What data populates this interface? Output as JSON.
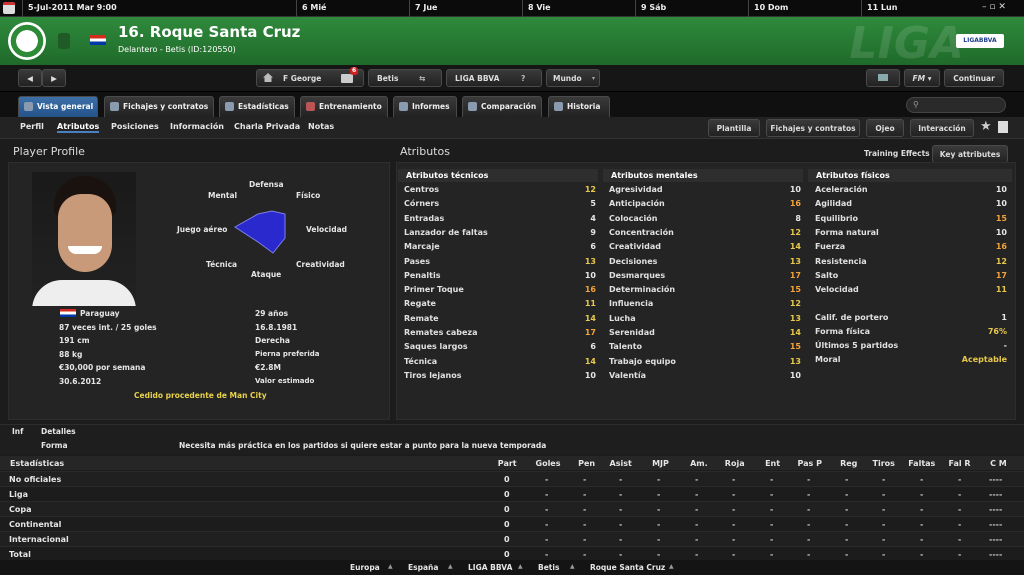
{
  "topbar": {
    "date": "5-Jul-2011 Mar 9:00",
    "days": [
      "6 Mié",
      "7 Jue",
      "8 Vie",
      "9 Sáb",
      "10 Dom",
      "11 Lun"
    ]
  },
  "player": {
    "title": "16. Roque Santa Cruz",
    "subtitle": "Delantero - Betis (ID:120550)"
  },
  "header": {
    "liga_watermark": "LIGA",
    "liga_logo": "LIGABBVA"
  },
  "toolbar": {
    "manager": "F George",
    "mail_count": "6",
    "club": "Betis",
    "league": "LIGA BBVA",
    "world": "Mundo",
    "fm": "FM",
    "continue": "Continuar"
  },
  "tabs": [
    "Vista general",
    "Fichajes y contratos",
    "Estadísticas",
    "Entrenamiento",
    "Informes",
    "Comparación",
    "Historia"
  ],
  "subtabs": [
    "Perfil",
    "Atributos",
    "Posiciones",
    "Información",
    "Charla Privada",
    "Notas"
  ],
  "actions": [
    "Plantilla",
    "Fichajes y contratos",
    "Ojeo",
    "Interacción"
  ],
  "profile": {
    "title": "Player Profile",
    "radar_labels": [
      "Defensa",
      "Físico",
      "Velocidad",
      "Creatividad",
      "Ataque",
      "Técnica",
      "Juego aéreo",
      "Mental"
    ],
    "nation": "Paraguay",
    "caps": "87 veces int. / 25 goles",
    "height": "191 cm",
    "weight": "88 kg",
    "wage": "€30,000 por semana",
    "contract": "30.6.2012",
    "age": "29 años",
    "dob": "16.8.1981",
    "foot": "Derecha",
    "foot_label": "Pierna preferida",
    "value": "€2.8M",
    "value_label": "Valor estimado",
    "loan": "Cedido procedente de Man City"
  },
  "attributes": {
    "title": "Atributos",
    "training_effects": "Training Effects",
    "key_attributes": "Key attributes",
    "technical_title": "Atributos técnicos",
    "mental_title": "Atributos mentales",
    "physical_title": "Atributos físicos",
    "technical": [
      {
        "n": "Centros",
        "v": "12"
      },
      {
        "n": "Córners",
        "v": "5"
      },
      {
        "n": "Entradas",
        "v": "4"
      },
      {
        "n": "Lanzador de faltas",
        "v": "9"
      },
      {
        "n": "Marcaje",
        "v": "6"
      },
      {
        "n": "Pases",
        "v": "13"
      },
      {
        "n": "Penaltis",
        "v": "10"
      },
      {
        "n": "Primer Toque",
        "v": "16"
      },
      {
        "n": "Regate",
        "v": "11"
      },
      {
        "n": "Remate",
        "v": "14"
      },
      {
        "n": "Remates cabeza",
        "v": "17"
      },
      {
        "n": "Saques largos",
        "v": "6"
      },
      {
        "n": "Técnica",
        "v": "14"
      },
      {
        "n": "Tiros lejanos",
        "v": "10"
      }
    ],
    "mental": [
      {
        "n": "Agresividad",
        "v": "10"
      },
      {
        "n": "Anticipación",
        "v": "16"
      },
      {
        "n": "Colocación",
        "v": "8"
      },
      {
        "n": "Concentración",
        "v": "12"
      },
      {
        "n": "Creatividad",
        "v": "14"
      },
      {
        "n": "Decisiones",
        "v": "13"
      },
      {
        "n": "Desmarques",
        "v": "17"
      },
      {
        "n": "Determinación",
        "v": "15"
      },
      {
        "n": "Influencia",
        "v": "12"
      },
      {
        "n": "Lucha",
        "v": "13"
      },
      {
        "n": "Serenidad",
        "v": "14"
      },
      {
        "n": "Talento",
        "v": "15"
      },
      {
        "n": "Trabajo equipo",
        "v": "13"
      },
      {
        "n": "Valentía",
        "v": "10"
      }
    ],
    "physical": [
      {
        "n": "Aceleración",
        "v": "10"
      },
      {
        "n": "Agilidad",
        "v": "10"
      },
      {
        "n": "Equilibrio",
        "v": "15"
      },
      {
        "n": "Forma natural",
        "v": "10"
      },
      {
        "n": "Fuerza",
        "v": "16"
      },
      {
        "n": "Resistencia",
        "v": "12"
      },
      {
        "n": "Salto",
        "v": "17"
      },
      {
        "n": "Velocidad",
        "v": "11"
      }
    ],
    "goalkeeper": {
      "n": "Calif. de portero",
      "v": "1"
    },
    "form": {
      "n": "Forma física",
      "v": "76%"
    },
    "last5": {
      "n": "Últimos 5 partidos",
      "v": "-"
    },
    "morale": {
      "n": "Moral",
      "v": "Aceptable"
    }
  },
  "details": {
    "inf": "Inf",
    "detalles": "Detalles",
    "forma": "Forma",
    "forma_text": "Necesita más práctica en los partidos si quiere estar a punto para la nueva temporada"
  },
  "stats": {
    "title": "Estadísticas",
    "columns": [
      "Part",
      "Goles",
      "Pen",
      "Asist",
      "MJP",
      "Am.",
      "Roja",
      "Ent",
      "Pas P",
      "Reg",
      "Tiros",
      "Faltas",
      "Fal R",
      "C M"
    ],
    "rows": [
      {
        "name": "No oficiales",
        "part": "0"
      },
      {
        "name": "Liga",
        "part": "0"
      },
      {
        "name": "Copa",
        "part": "0"
      },
      {
        "name": "Continental",
        "part": "0"
      },
      {
        "name": "Internacional",
        "part": "0"
      },
      {
        "name": "Total",
        "part": "0"
      }
    ],
    "dash": "-",
    "cm": "----"
  },
  "breadcrumb": [
    "Europa",
    "España",
    "LIGA BBVA",
    "Betis",
    "Roque Santa Cruz"
  ]
}
